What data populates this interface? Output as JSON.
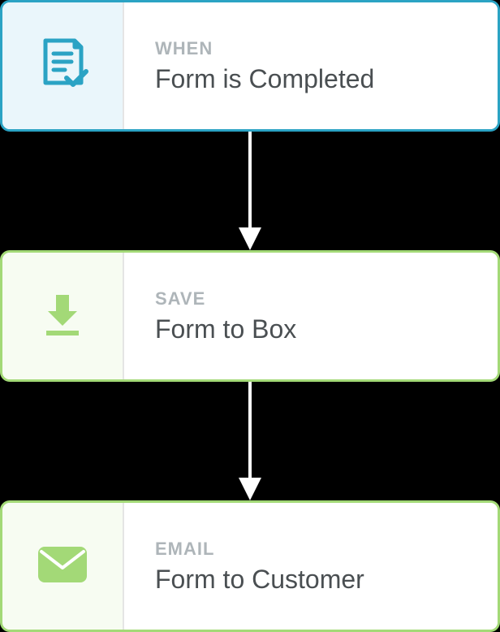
{
  "steps": [
    {
      "label": "WHEN",
      "title": "Form is Completed",
      "icon": "form-check-icon",
      "color": "blue"
    },
    {
      "label": "SAVE",
      "title": "Form to Box",
      "icon": "download-icon",
      "color": "green"
    },
    {
      "label": "EMAIL",
      "title": "Form to Customer",
      "icon": "email-icon",
      "color": "green"
    }
  ],
  "colors": {
    "blue": "#2ba3c4",
    "green": "#a3d977"
  }
}
